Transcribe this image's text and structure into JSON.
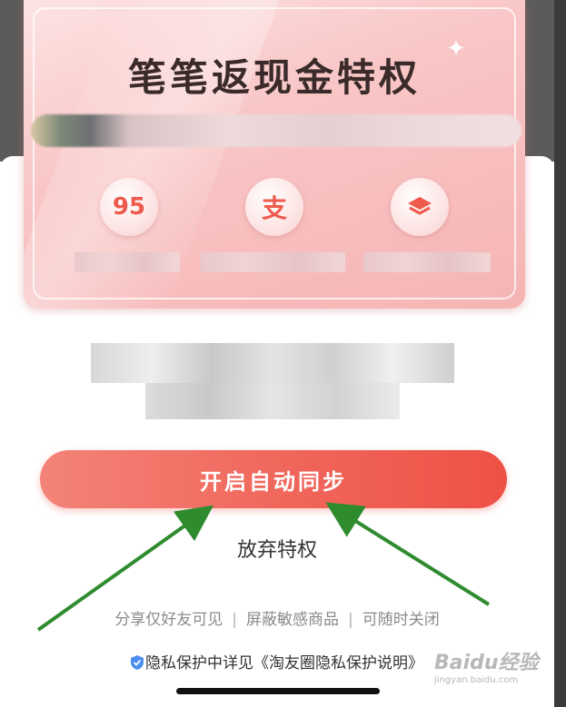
{
  "card": {
    "title": "笔笔返现金特权",
    "features": [
      {
        "icon": "badge-95-icon",
        "text": "95"
      },
      {
        "icon": "alipay-icon",
        "text": "支"
      },
      {
        "icon": "layers-icon",
        "text": ""
      }
    ]
  },
  "actions": {
    "primary_label": "开启自动同步",
    "secondary_label": "放弃特权"
  },
  "notes": {
    "item1": "分享仅好友可见",
    "item2": "屏蔽敏感商品",
    "item3": "可随时关闭",
    "separator": "|"
  },
  "privacy": {
    "text": "隐私保护中详见",
    "link": "《淘友圈隐私保护说明》"
  },
  "watermark": {
    "main": "Baidu经验",
    "sub": "jingyan.baidu.com"
  },
  "colors": {
    "accent": "#f0655a",
    "card_pink": "#f9c6c6",
    "annotation_arrow": "#2e8b2e",
    "shield_blue": "#4a8ef0"
  }
}
